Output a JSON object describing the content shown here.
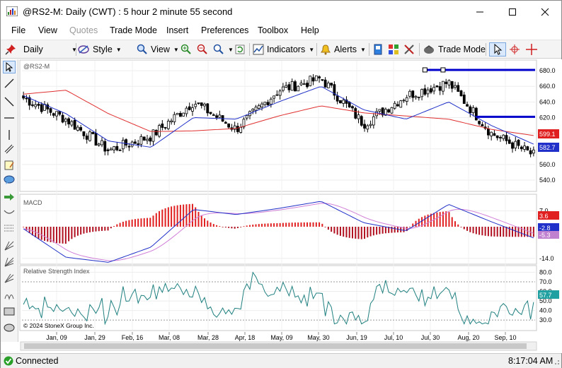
{
  "window": {
    "title": "@RS2-M: Daily (CWT) : 5 hour 2 minute 55 second"
  },
  "menu": [
    "File",
    "View",
    "Quotes",
    "Trade Mode",
    "Insert",
    "Preferences",
    "Toolbox",
    "Help"
  ],
  "toolbar": {
    "interval": "Daily",
    "style": "Style",
    "view": "View",
    "indicators": "Indicators",
    "alerts": "Alerts",
    "trade_mode": "Trade Mode"
  },
  "chart": {
    "symbol": "@RS2-M",
    "copyright": "© 2024 StoneX Group Inc.",
    "macd_label": "MACD",
    "rsi_label": "Relative Strength Index",
    "price_ticks": [
      "680.0",
      "660.0",
      "640.0",
      "620.0",
      "600.0",
      "580.0",
      "560.0",
      "540.0"
    ],
    "macd_ticks": [
      "7.0",
      "-14.0"
    ],
    "rsi_ticks": [
      "80.0",
      "70.0",
      "60.0",
      "50.0",
      "40.0",
      "30.0"
    ],
    "x_ticks": [
      "Jan, 09",
      "Jan, 29",
      "Feb, 16",
      "Mar, 08",
      "Mar, 28",
      "Apr, 18",
      "May, 09",
      "May, 30",
      "Jun, 19",
      "Jul, 10",
      "Jul, 30",
      "Aug, 20",
      "Sep, 10"
    ],
    "last_price": "599.1",
    "ma_value": "582.7",
    "macd_values": [
      "3.6",
      "-2.8",
      "-5.3"
    ],
    "rsi_value": "57.7",
    "colors": {
      "up": "#000000",
      "down": "#000000",
      "ma_fast": "#2030c8",
      "ma_slow": "#e03030",
      "macd_hist_up": "#e02020",
      "macd_hist_dn": "#b01020",
      "rsi": "#208080",
      "hline": "#0000cc"
    }
  },
  "chart_data": {
    "type": "line",
    "title": "@RS2-M",
    "x": [
      "Jan, 09",
      "Jan, 29",
      "Feb, 16",
      "Mar, 08",
      "Mar, 28",
      "Apr, 18",
      "May, 09",
      "May, 30",
      "Jun, 19",
      "Jul, 10",
      "Jul, 30",
      "Aug, 20",
      "Sep, 10"
    ],
    "series": [
      {
        "values": [
          645,
          618,
          578,
          596,
          640,
          605,
          655,
          670,
          612,
          648,
          665,
          600,
          572
        ]
      },
      {
        "values": [
          648,
          625,
          590,
          582,
          620,
          618,
          640,
          660,
          630,
          618,
          640,
          610,
          586
        ]
      },
      {
        "values": [
          650,
          655,
          625,
          602,
          603,
          606,
          622,
          635,
          626,
          622,
          618,
          605,
          597
        ]
      }
    ],
    "ylim": [
      530,
      690
    ],
    "horizontal_levels": [
      681,
      621
    ],
    "last_price": 599.1
  },
  "status": {
    "connection": "Connected",
    "time": "8:17:04 AM"
  }
}
